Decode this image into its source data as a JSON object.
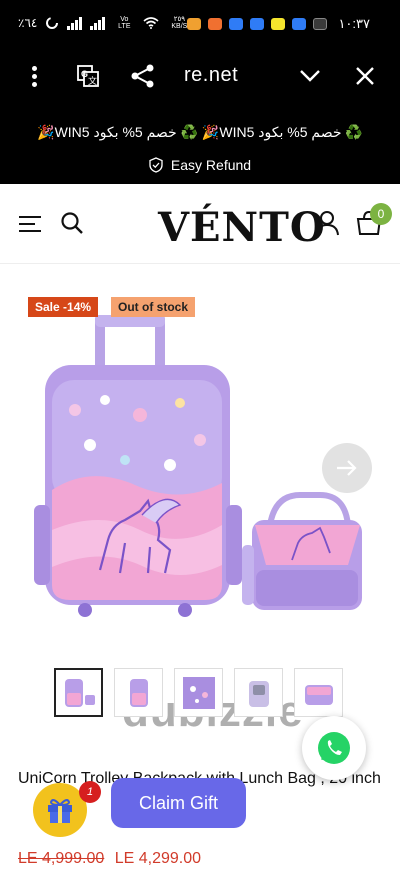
{
  "status_bar": {
    "left_text": "٪٦٤",
    "net_speed": "٢٥٩ KB/S",
    "time": "١٠:٣٧",
    "network": "Vo LTE"
  },
  "browser": {
    "url_fragment": "re.net",
    "icons": [
      "more-vert-icon",
      "translate-icon",
      "share-icon",
      "chevron-down-icon",
      "close-icon"
    ]
  },
  "promo": {
    "ticker": "🎉WIN5 خصم 5% بكود ♻️     🎉WIN5 خصم 5% بكود ♻️",
    "refund": "Easy Refund"
  },
  "store": {
    "logo": "VÉNTO",
    "cart_count": "0"
  },
  "product": {
    "badges": {
      "sale": "Sale -14%",
      "stock": "Out of stock"
    },
    "watermark": "dubizzle",
    "title": "UniCorn Trolley Backpack with Lunch Bag , 20 inch",
    "old_price": "LE 4,999.00",
    "price": "LE 4,299.00",
    "thumbnail_count": 5
  },
  "floating": {
    "claim_label": "Claim Gift",
    "gift_badge": "1"
  },
  "colors": {
    "accent": "#6868e8",
    "sale": "#d64718",
    "stock": "#f5a26f",
    "cart_badge": "#7cb342",
    "bag_purple": "#b89ee8",
    "bag_pink": "#f2a6d4"
  }
}
